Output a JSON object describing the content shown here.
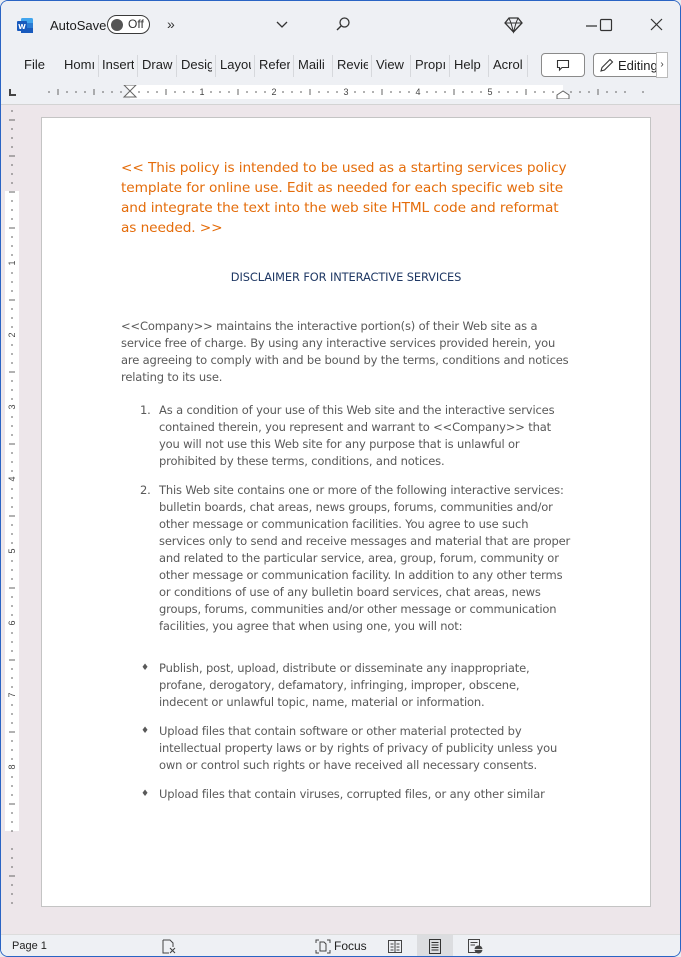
{
  "titlebar": {
    "autosave_label": "AutoSave",
    "autosave_state": "Off",
    "more_commands": "»"
  },
  "ribbon": {
    "tabs": [
      "File",
      "Home",
      "Insert",
      "Draw",
      "Design",
      "Layout",
      "References",
      "Mailings",
      "Review",
      "View",
      "Properties",
      "Help",
      "Acrobat"
    ],
    "tabs_visible": [
      "File",
      "Homı",
      "Insert",
      "Draw",
      "Desig",
      "Layou",
      "Refer",
      "Maili",
      "Revie",
      "View",
      "Propı",
      "Help",
      "Acrol"
    ],
    "editing_label": "Editing",
    "scroll_right": "›"
  },
  "ruler": {
    "h_labels": [
      "1",
      "2",
      "3",
      "4",
      "5"
    ],
    "v_labels": [
      "1",
      "2",
      "3",
      "4",
      "5",
      "6",
      "7",
      "8"
    ]
  },
  "document": {
    "note": "<< This policy is intended to be used as a starting services policy template for online use.  Edit as needed for each specific web site and integrate the text into the web site HTML code and reformat as needed. >>",
    "heading": "DISCLAIMER FOR INTERACTIVE SERVICES",
    "intro": "<<Company>> maintains the interactive portion(s) of their Web site as a service free of charge. By using any interactive services provided herein, you are agreeing to comply with and be bound by the terms, conditions and notices relating to its use.",
    "numbered": [
      {
        "n": "1.",
        "text": "As a condition of your use of this Web site and the interactive services contained therein, you represent and warrant to <<Company>> that you will not use this Web site for any purpose that is unlawful or prohibited by these terms, conditions, and notices."
      },
      {
        "n": "2.",
        "text": "This Web site contains one or more of the following interactive services: bulletin boards, chat areas, news groups, forums, communities and/or other message or communication facilities.  You agree to use such services only to send and receive messages and material that are proper and related to the particular service, area, group, forum, community or other message or communication facility. In addition to any other terms or conditions of use of any bulletin board services, chat areas, news groups, forums, communities and/or other message or communication facilities, you agree that when using one, you will not:"
      }
    ],
    "bullets": [
      "Publish, post, upload, distribute or disseminate any inappropriate, profane, derogatory, defamatory, infringing, improper, obscene, indecent or unlawful topic, name, material or information.",
      "Upload files that contain software or other material protected by intellectual property laws or by rights of privacy of publicity unless you own or control such rights or have received all necessary consents.",
      "Upload files that contain viruses, corrupted files, or any other similar"
    ],
    "bullet_glyph": "♦"
  },
  "statusbar": {
    "page": "Page 1",
    "focus_label": "Focus"
  },
  "colors": {
    "note": "#e46c0a",
    "heading": "#1f3864",
    "body_text": "#595959",
    "window_border": "#2a64c4",
    "word_blue": "#185abd"
  }
}
